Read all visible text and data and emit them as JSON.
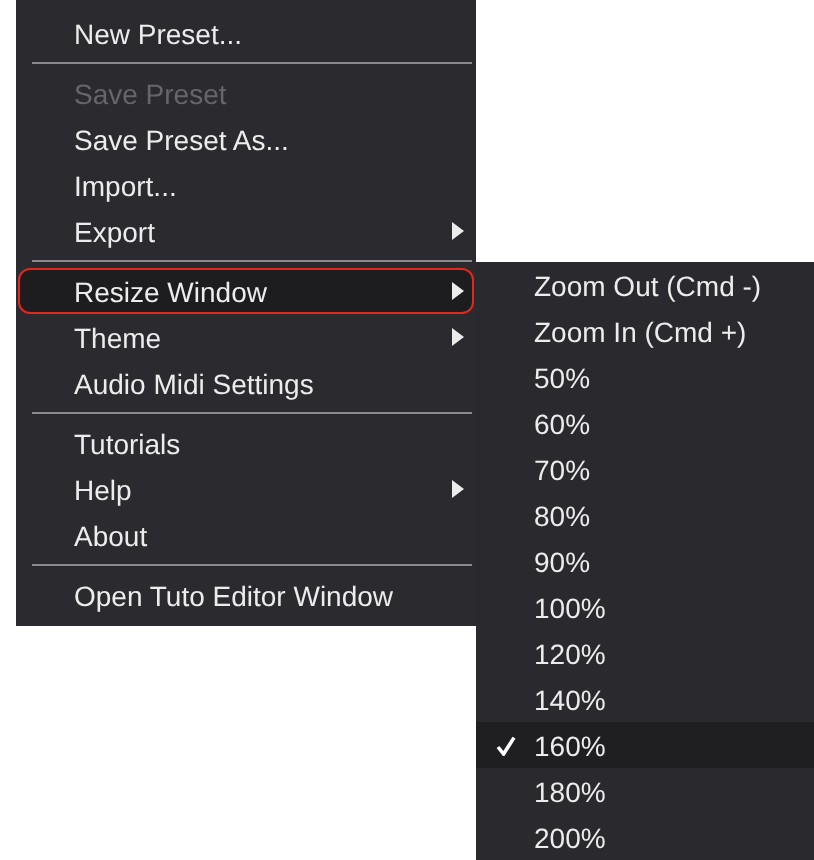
{
  "menu": {
    "groups": [
      {
        "items": [
          {
            "label": "New Preset...",
            "disabled": false,
            "submenu": false,
            "selected": false
          }
        ]
      },
      {
        "items": [
          {
            "label": "Save Preset",
            "disabled": true,
            "submenu": false,
            "selected": false
          },
          {
            "label": "Save Preset As...",
            "disabled": false,
            "submenu": false,
            "selected": false
          },
          {
            "label": "Import...",
            "disabled": false,
            "submenu": false,
            "selected": false
          },
          {
            "label": "Export",
            "disabled": false,
            "submenu": true,
            "selected": false
          }
        ]
      },
      {
        "items": [
          {
            "label": "Resize Window",
            "disabled": false,
            "submenu": true,
            "selected": true
          },
          {
            "label": "Theme",
            "disabled": false,
            "submenu": true,
            "selected": false
          },
          {
            "label": "Audio Midi Settings",
            "disabled": false,
            "submenu": false,
            "selected": false
          }
        ]
      },
      {
        "items": [
          {
            "label": "Tutorials",
            "disabled": false,
            "submenu": false,
            "selected": false
          },
          {
            "label": "Help",
            "disabled": false,
            "submenu": true,
            "selected": false
          },
          {
            "label": "About",
            "disabled": false,
            "submenu": false,
            "selected": false
          }
        ]
      },
      {
        "items": [
          {
            "label": "Open Tuto Editor Window",
            "disabled": false,
            "submenu": false,
            "selected": false
          }
        ]
      }
    ]
  },
  "submenu": {
    "items": [
      {
        "label": "Zoom Out (Cmd -)",
        "checked": false
      },
      {
        "label": "Zoom In (Cmd +)",
        "checked": false
      },
      {
        "label": "50%",
        "checked": false
      },
      {
        "label": "60%",
        "checked": false
      },
      {
        "label": "70%",
        "checked": false
      },
      {
        "label": "80%",
        "checked": false
      },
      {
        "label": "90%",
        "checked": false
      },
      {
        "label": "100%",
        "checked": false
      },
      {
        "label": "120%",
        "checked": false
      },
      {
        "label": "140%",
        "checked": false
      },
      {
        "label": "160%",
        "checked": true
      },
      {
        "label": "180%",
        "checked": false
      },
      {
        "label": "200%",
        "checked": false
      }
    ]
  }
}
